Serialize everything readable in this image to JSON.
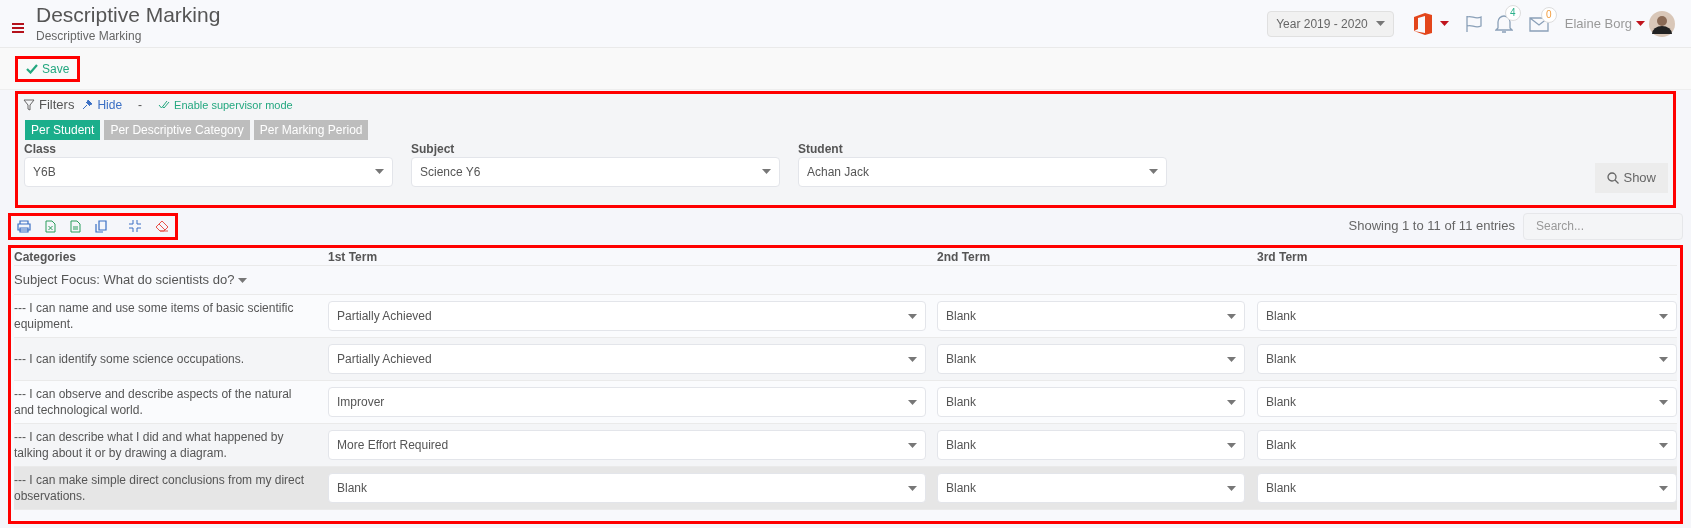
{
  "header": {
    "title": "Descriptive Marking",
    "subtitle": "Descriptive Marking",
    "year": "Year 2019 - 2020",
    "notifications": "4",
    "messages": "0",
    "user": "Elaine Borg"
  },
  "toolbar": {
    "save": "Save"
  },
  "filters": {
    "label": "Filters",
    "hide": "Hide",
    "separator": "-",
    "supervisor": "Enable supervisor mode",
    "modes": [
      {
        "label": "Per Student",
        "selected": true
      },
      {
        "label": "Per Descriptive Category",
        "selected": false
      },
      {
        "label": "Per Marking Period",
        "selected": false
      }
    ],
    "fields": [
      {
        "label": "Class",
        "value": "Y6B"
      },
      {
        "label": "Subject",
        "value": "Science Y6"
      },
      {
        "label": "Student",
        "value": "Achan Jack"
      }
    ],
    "show": "Show"
  },
  "info": "Showing 1 to 11 of 11 entries",
  "search": {
    "placeholder": "Search..."
  },
  "table": {
    "columns": [
      "Categories",
      "1st Term",
      "2nd Term",
      "3rd Term"
    ],
    "group": "Subject Focus: What do scientists do?",
    "rows": [
      {
        "category": "--- I can name and use some items of basic scientific equipment.",
        "marks": [
          "Partially Achieved",
          "Blank",
          "Blank"
        ],
        "selected": false
      },
      {
        "category": "--- I can identify some science occupations.",
        "marks": [
          "Partially Achieved",
          "Blank",
          "Blank"
        ],
        "selected": false
      },
      {
        "category": "--- I can observe and describe aspects of the natural and technological world.",
        "marks": [
          "Improver",
          "Blank",
          "Blank"
        ],
        "selected": false
      },
      {
        "category": "--- I can describe what I did and what happened by talking about it or by drawing a diagram.",
        "marks": [
          "More Effort Required",
          "Blank",
          "Blank"
        ],
        "selected": false
      },
      {
        "category": "--- I can make simple direct conclusions from my direct observations.",
        "marks": [
          "Blank",
          "Blank",
          "Blank"
        ],
        "selected": true
      }
    ]
  }
}
